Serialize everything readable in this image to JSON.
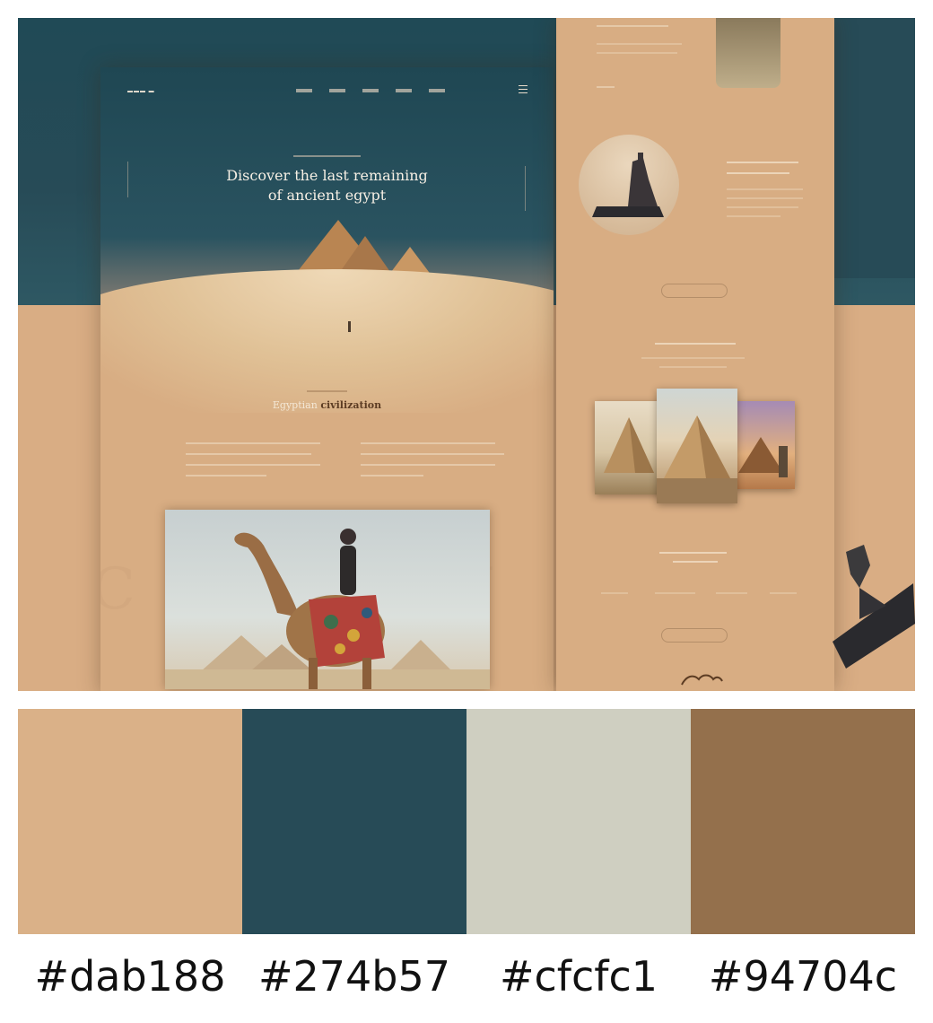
{
  "mockup": {
    "hero": {
      "title_line1": "Discover the last remaining",
      "title_line2": "of ancient egypt"
    },
    "section_title_highlight": "Egyptian",
    "section_title_rest": "civilization"
  },
  "palette": {
    "colors": [
      "#dab188",
      "#274b57",
      "#cfcfc1",
      "#94704c"
    ],
    "labels": [
      "#dab188",
      "#274b57",
      "#cfcfc1",
      "#94704c"
    ]
  }
}
